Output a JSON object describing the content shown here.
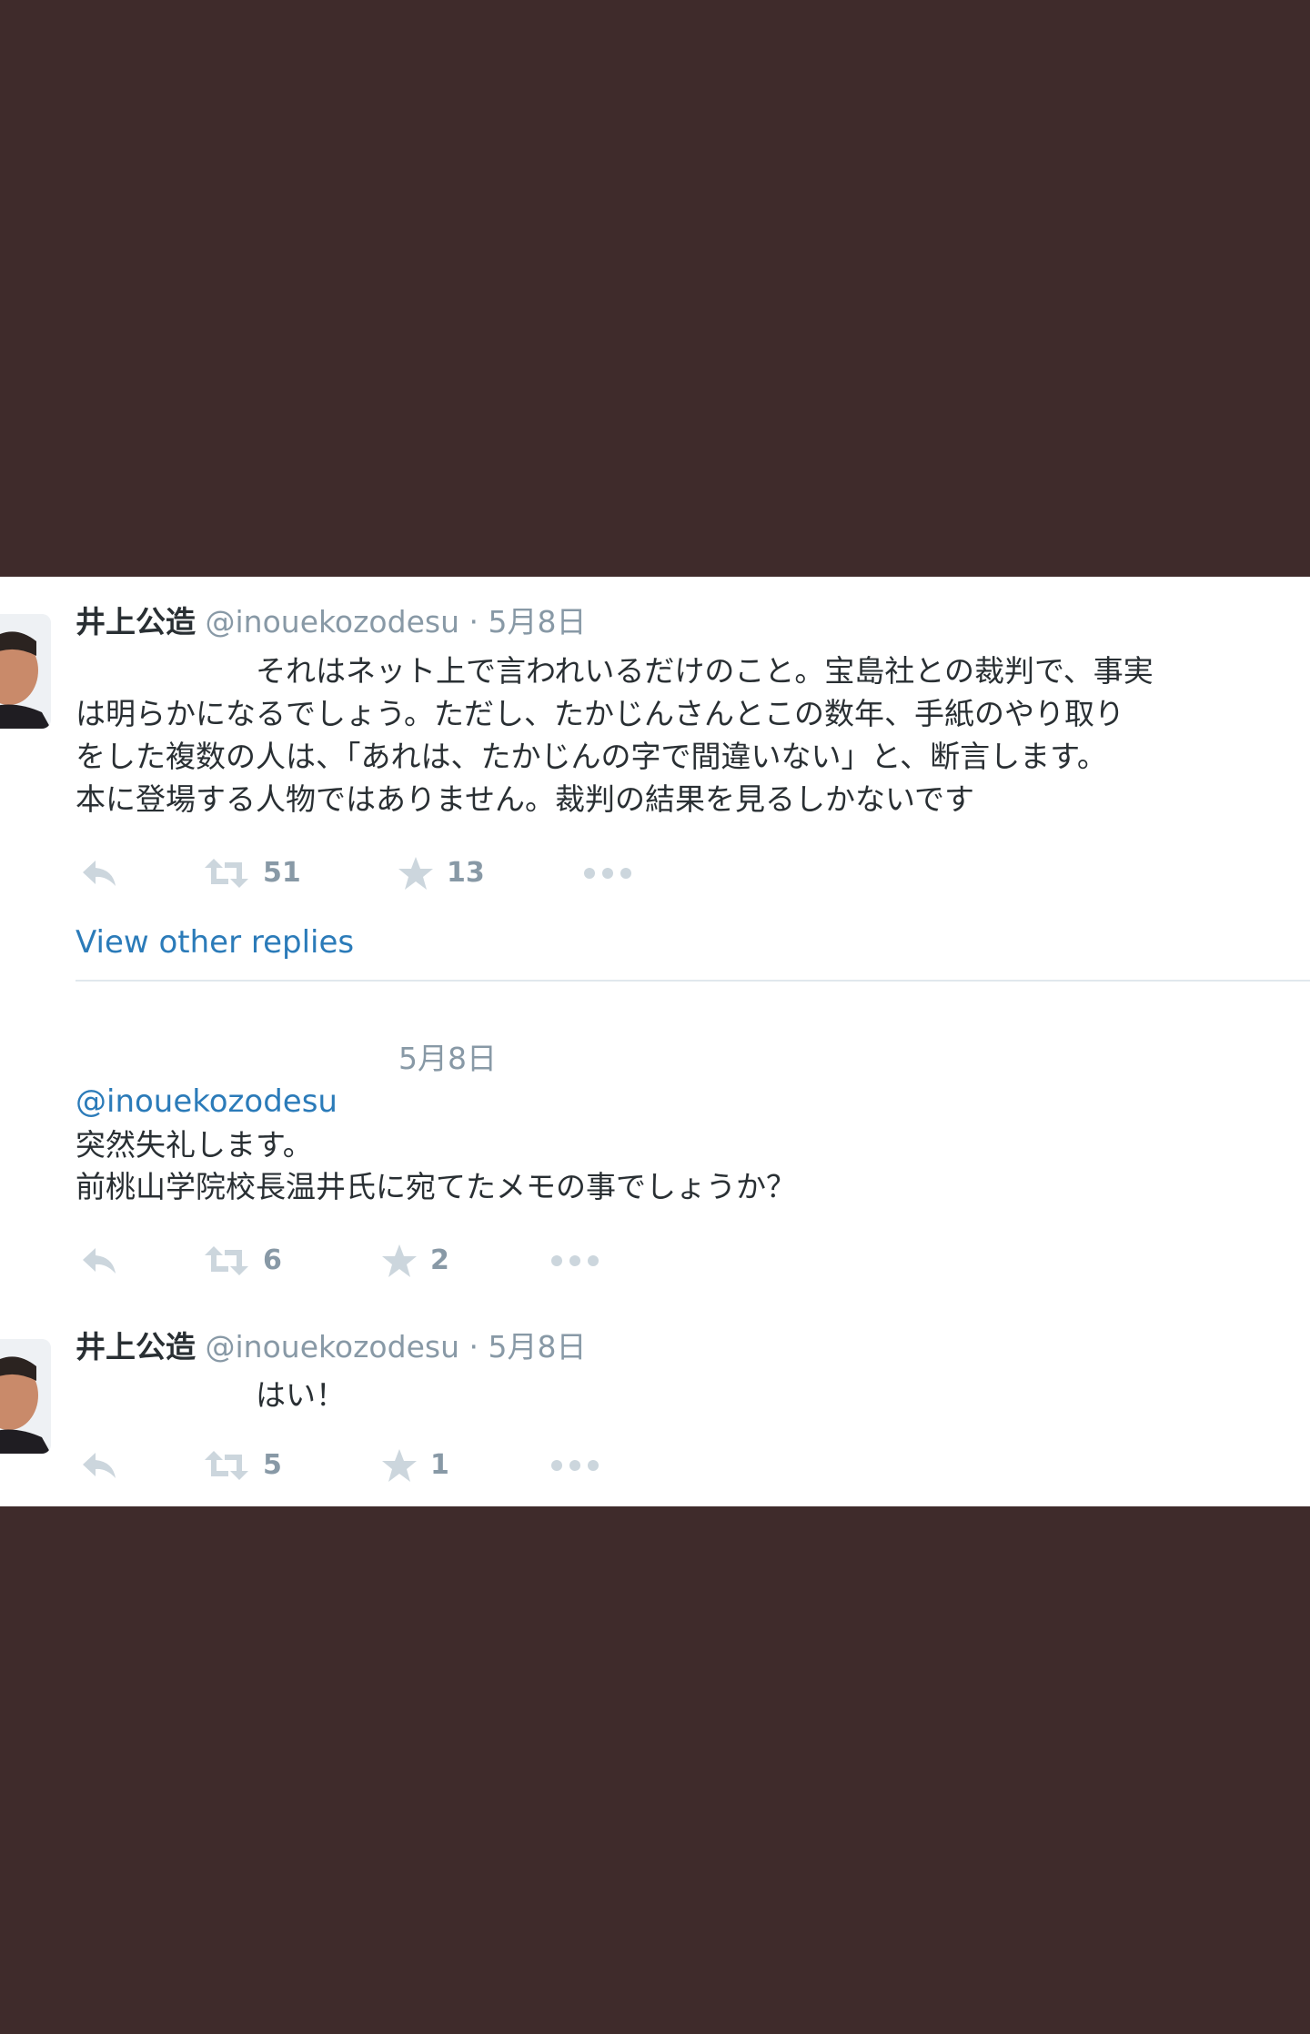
{
  "tweet1": {
    "name": "井上公造",
    "handle": "@inouekozodesu",
    "separator": "·",
    "date": "5月8日",
    "text_lines": [
      "　　　　　　それはネット上で言われいるだけのこと。宝島社との裁判で、事実",
      "は明らかになるでしょう。ただし、たかじんさんとこの数年、手紙のやり取り",
      "をした複数の人は、「あれは、たかじんの字で間違いない」と、断言します。",
      "本に登場する人物ではありません。裁判の結果を見るしかないです"
    ],
    "retweets": "51",
    "favorites": "13",
    "view_other_replies": "View other replies"
  },
  "reply": {
    "date": "5月8日",
    "mention": "@inouekozodesu",
    "line1": "突然失礼します。",
    "line2": "前桃山学院校長温井氏に宛てたメモの事でしょうか？",
    "retweets": "6",
    "favorites": "2"
  },
  "tweet2": {
    "name": "井上公造",
    "handle": "@inouekozodesu",
    "separator": "·",
    "date": "5月8日",
    "text": "　　　　　　はい！",
    "retweets": "5",
    "favorites": "1"
  },
  "colors": {
    "background": "#3f2b2b",
    "panel": "#ffffff",
    "link": "#2b7bb9",
    "muted": "#8899a6",
    "text": "#292f33"
  },
  "icons": [
    "reply-icon",
    "retweet-icon",
    "favorite-icon",
    "more-icon",
    "avatar"
  ]
}
